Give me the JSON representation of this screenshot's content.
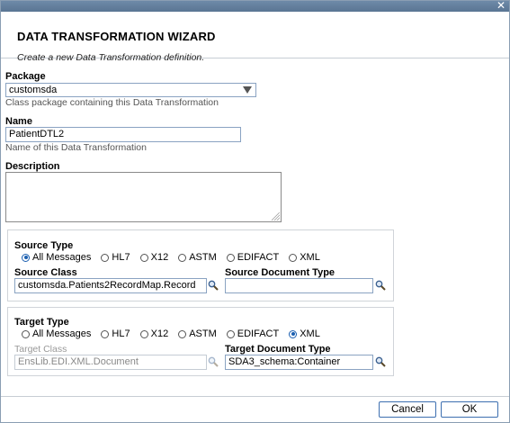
{
  "window": {
    "close_symbol": "✕"
  },
  "header": {
    "title": "DATA TRANSFORMATION WIZARD",
    "subtitle": "Create a new Data Transformation definition."
  },
  "package": {
    "label": "Package",
    "value": "customsda",
    "hint": "Class package containing this Data Transformation"
  },
  "name": {
    "label": "Name",
    "value": "PatientDTL2",
    "hint": "Name of this Data Transformation"
  },
  "description": {
    "label": "Description",
    "value": ""
  },
  "source": {
    "type_label": "Source Type",
    "options": [
      "All Messages",
      "HL7",
      "X12",
      "ASTM",
      "EDIFACT",
      "XML"
    ],
    "selected": "All Messages",
    "class_label": "Source Class",
    "class_value": "customsda.Patients2RecordMap.Record",
    "doc_type_label": "Source Document Type",
    "doc_type_value": ""
  },
  "target": {
    "type_label": "Target Type",
    "options": [
      "All Messages",
      "HL7",
      "X12",
      "ASTM",
      "EDIFACT",
      "XML"
    ],
    "selected": "XML",
    "class_label": "Target Class",
    "class_value": "EnsLib.EDI.XML.Document",
    "doc_type_label": "Target Document Type",
    "doc_type_value": "SDA3_schema:Container"
  },
  "footer": {
    "cancel_label": "Cancel",
    "ok_label": "OK"
  },
  "icons": {
    "search": "magnifier-icon",
    "close": "close-icon",
    "dropdown": "triangle-down-icon"
  },
  "colors": {
    "accent": "#1b5fb0",
    "titlebar": "#6e8aa8",
    "border": "#8aa3c2"
  }
}
